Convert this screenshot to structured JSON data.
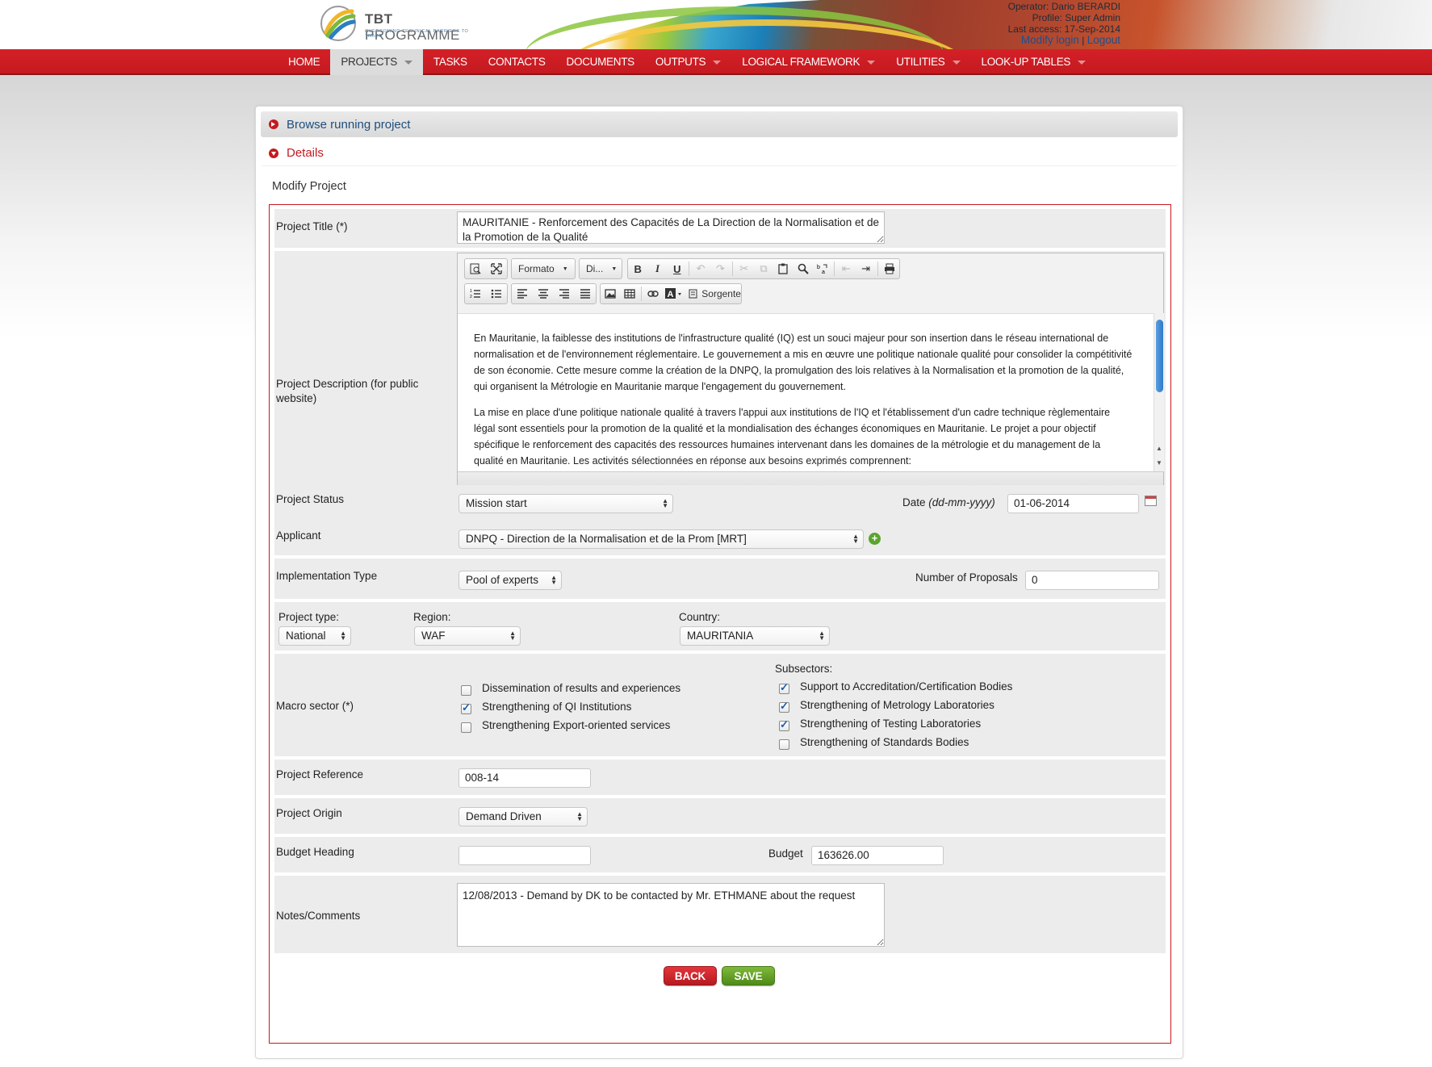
{
  "header": {
    "logo_title_bold": "TBT",
    "logo_title_rest": " PROGRAMME",
    "logo_subtitle": "OVERCOMING TECHNICAL BARRIERS TO TRADE",
    "operator": "Operator: Dario BERARDI",
    "profile": "Profile: Super Admin",
    "last_access": "Last access: 17-Sep-2014",
    "modify_login": "Modify login",
    "separator": "|",
    "logout": "Logout"
  },
  "nav": {
    "home": "HOME",
    "projects": "PROJECTS",
    "tasks": "TASKS",
    "contacts": "CONTACTS",
    "documents": "DOCUMENTS",
    "outputs": "OUTPUTS",
    "logical_framework": "LOGICAL FRAMEWORK",
    "utilities": "UTILITIES",
    "lookup_tables": "LOOK-UP TABLES"
  },
  "accordion": {
    "browse": "Browse running project",
    "details": "Details"
  },
  "form": {
    "heading": "Modify Project",
    "project_title_label": "Project Title (*)",
    "project_title_value": "MAURITANIE - Renforcement des Capacités de La Direction de la Normalisation et de la Promotion de la Qualité",
    "description_label": "Project Description (for public website)",
    "editor": {
      "format_combo": "Formato",
      "size_combo": "Di...",
      "source_button": "Sorgente",
      "paragraph_1": "En Mauritanie, la faiblesse des institutions de l'infrastructure qualité (IQ) est un souci majeur pour son insertion dans le réseau international de normalisation et de l'environnement réglementaire. Le gouvernement a mis en œuvre une politique nationale qualité pour consolider la compétitivité de son économie. Cette mesure comme la création de la DNPQ, la promulgation des lois relatives à la Normalisation et la promotion de la qualité, qui organisent la Métrologie en Mauritanie marque l'engagement du gouvernement.",
      "paragraph_2": "La mise en place d'une politique nationale qualité à travers l'appui aux institutions de l'IQ et l'établissement d'un cadre technique règlementaire légal sont essentiels pour la promotion de la qualité et la mondialisation des échanges économiques en Mauritanie. Le projet a pour objectif spécifique le renforcement des capacités des ressources humaines intervenant dans les domaines de la métrologie et du management de la qualité en Mauritanie. Les activités sélectionnées en réponse aux besoins exprimés comprennent:"
    },
    "status_label": "Project Status",
    "status_value": "Mission start",
    "date_label_plain": "Date ",
    "date_label_italic": "(dd-mm-yyyy)",
    "date_value": "01-06-2014",
    "applicant_label": "Applicant",
    "applicant_value": "DNPQ - Direction de la Normalisation et de la Prom [MRT]",
    "implementation_label": "Implementation Type",
    "implementation_value": "Pool of experts",
    "proposals_label": "Number of Proposals",
    "proposals_value": "0",
    "project_type_label": "Project type:",
    "project_type_value": "National",
    "region_label": "Region:",
    "region_value": "WAF",
    "country_label": "Country:",
    "country_value": "MAURITANIA",
    "macro_label": "Macro sector (*)",
    "macro_items": [
      {
        "label": "Dissemination of results and experiences",
        "checked": false
      },
      {
        "label": "Strengthening of QI Institutions",
        "checked": true
      },
      {
        "label": "Strengthening Export-oriented services",
        "checked": false
      }
    ],
    "subsectors_label": "Subsectors:",
    "subsector_items": [
      {
        "label": "Support to Accreditation/Certification Bodies",
        "checked": true
      },
      {
        "label": "Strengthening of Metrology Laboratories",
        "checked": true
      },
      {
        "label": "Strengthening of Testing Laboratories",
        "checked": true
      },
      {
        "label": "Strengthening of Standards Bodies",
        "checked": false
      }
    ],
    "reference_label": "Project Reference",
    "reference_value": "008-14",
    "origin_label": "Project Origin",
    "origin_value": "Demand Driven",
    "budget_heading_label": "Budget Heading",
    "budget_heading_value": "",
    "budget_label": "Budget",
    "budget_value": "163626.00",
    "notes_label": "Notes/Comments",
    "notes_value": "12/08/2013 - Demand by DK to be contacted by Mr. ETHMANE about the request"
  },
  "buttons": {
    "back": "BACK",
    "save": "SAVE"
  },
  "colors": {
    "nav_red": "#c41a20",
    "link_blue": "#1d4f8f",
    "save_green": "#5c9a22",
    "check_blue": "#1a5fa8"
  }
}
